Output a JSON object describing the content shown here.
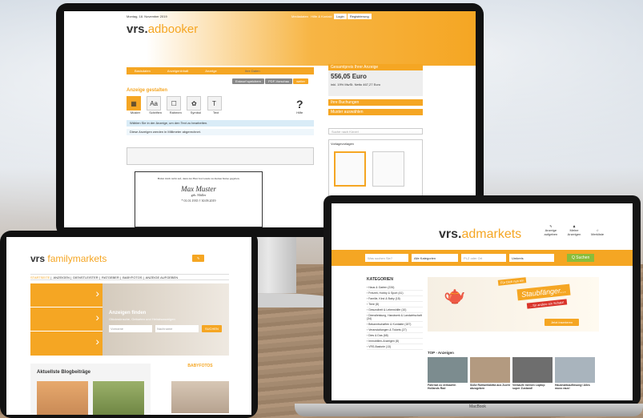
{
  "monitor": {
    "date": "Montag, 18. November 2019",
    "toplinks": [
      "Mediadaten",
      "Hilfe & Kontakt",
      "Login",
      "Registrierung"
    ],
    "logo_a": "vrs.",
    "logo_b": "adbooker",
    "steps": [
      "Basisdaten",
      "Anzeigeninhalt",
      "Anzeige",
      "Ihre Daten"
    ],
    "save_btn": "Entwurf speichern",
    "preview_btn": "PDF-Vorschau",
    "next_btn": "weiter",
    "section_title": "Anzeige gestalten",
    "tools": [
      "Muster",
      "Schriften",
      "Rahmen",
      "Symbol",
      "Text"
    ],
    "help": "Hilfe",
    "info": "Wählen Sie in der Anzeige, um den Text zu bearbeiten.",
    "status": "Diese Anzeigen werden in Millimeter abgerechnet.",
    "price_title": "Gesamtpreis Ihrer Anzeige",
    "price": "556,05 Euro",
    "price_sub": "inkl. 19% MwSt. Netto 467,27 Euro",
    "bookings": "Ihre Buchungen",
    "layout_title": "Muster auswählen",
    "search_placeholder": "Suche nach Kürzel",
    "templates_title": "Vorlagevorlagen",
    "ad_line1": "Haltet mich nicht auf, denn der Herr hat Gnade zu meiner Reise gegeben.",
    "ad_name": "Max Muster",
    "ad_born": "geb. Müller",
    "ad_dates": "* 01.01.1935     † 30.09.2019"
  },
  "tablet": {
    "logo_a": "vrs ",
    "logo_b": "familymarkets",
    "nav": [
      "STARTSEITE",
      "ANZEIGEN",
      "DIENSTLEISTER",
      "RATGEBER",
      "BABYFOTOS",
      "ANZEIGE AUFGEBEN"
    ],
    "hero_title": "Anzeigen finden",
    "hero_sub": "Glückwünsche, Geburten und Heiratsanzeigen",
    "name_placeholder": "Vorname",
    "last_placeholder": "Nachname",
    "search_btn": "SUCHEN",
    "blog_title": "Aktuellste Blogbeiträge",
    "baby_title": "BABYFOTOS"
  },
  "laptop": {
    "logo_a": "vrs.",
    "logo_b": "admarkets",
    "icons": [
      "Anzeige aufgeben",
      "Meine Anzeigen",
      "Merkliste"
    ],
    "search_placeholder": "Was suchen Sie?",
    "cat_select": "Alle Kategorien",
    "zip_placeholder": "PLZ oder Ort",
    "radius": "Umkreis",
    "search_btn": "Q Suchen",
    "cat_title": "KATEGORIEN",
    "categories": [
      "Haus & Garten (226)",
      "Freizeit, Hobby & Sport (41)",
      "Familie, Kind & Baby (18)",
      "Tiere (8)",
      "Gesundheit & Lebenshilfe (10)",
      "Dienstleistung, Handwerk & Landwirtschaft (34)",
      "Bekanntschaften & Kontakte (187)",
      "Veranstaltungen & Tickets (27)",
      "Dies & Das (68)",
      "Immobilien-Anzeigen (8)",
      "VRS-Basisrie (13)"
    ],
    "banner_small": "Für Dich nun ein",
    "banner_big": "Staubfänger...",
    "banner_tag": "...für andere ein Schatz!",
    "banner_btn": "Jetzt inserieren",
    "top_title": "TOP - Anzeigen",
    "top_items": [
      "Fahrrad zu verkaufen Hollands Rad",
      "Süße Rottweilakitta aus Zucht abzugeben",
      "Verkaufe meinen Laptop super Zustand!",
      "Haushaltsauflösung! Alles muss raus!"
    ],
    "brand": "MacBook"
  }
}
